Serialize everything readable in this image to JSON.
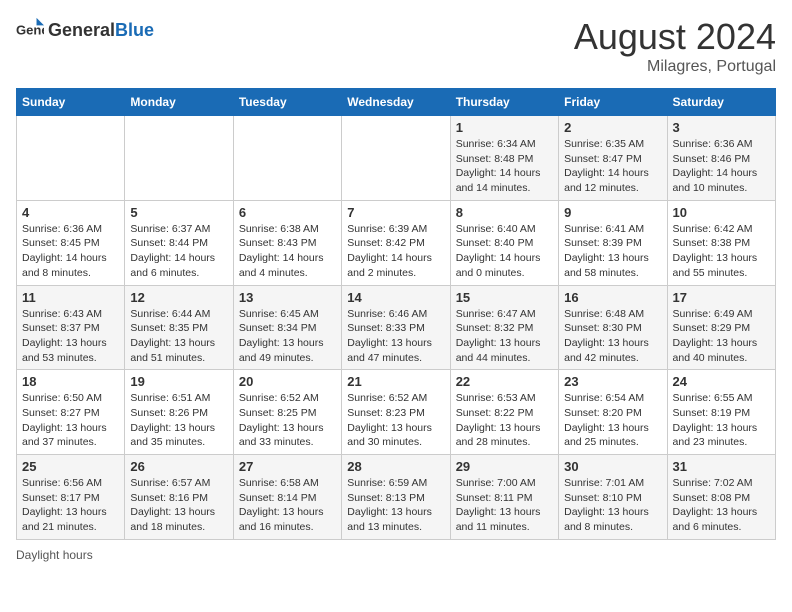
{
  "header": {
    "logo_general": "General",
    "logo_blue": "Blue",
    "month_year": "August 2024",
    "location": "Milagres, Portugal"
  },
  "days_of_week": [
    "Sunday",
    "Monday",
    "Tuesday",
    "Wednesday",
    "Thursday",
    "Friday",
    "Saturday"
  ],
  "footer": {
    "note": "Daylight hours"
  },
  "weeks": [
    [
      {
        "day": "",
        "info": ""
      },
      {
        "day": "",
        "info": ""
      },
      {
        "day": "",
        "info": ""
      },
      {
        "day": "",
        "info": ""
      },
      {
        "day": "1",
        "info": "Sunrise: 6:34 AM\nSunset: 8:48 PM\nDaylight: 14 hours and 14 minutes."
      },
      {
        "day": "2",
        "info": "Sunrise: 6:35 AM\nSunset: 8:47 PM\nDaylight: 14 hours and 12 minutes."
      },
      {
        "day": "3",
        "info": "Sunrise: 6:36 AM\nSunset: 8:46 PM\nDaylight: 14 hours and 10 minutes."
      }
    ],
    [
      {
        "day": "4",
        "info": "Sunrise: 6:36 AM\nSunset: 8:45 PM\nDaylight: 14 hours and 8 minutes."
      },
      {
        "day": "5",
        "info": "Sunrise: 6:37 AM\nSunset: 8:44 PM\nDaylight: 14 hours and 6 minutes."
      },
      {
        "day": "6",
        "info": "Sunrise: 6:38 AM\nSunset: 8:43 PM\nDaylight: 14 hours and 4 minutes."
      },
      {
        "day": "7",
        "info": "Sunrise: 6:39 AM\nSunset: 8:42 PM\nDaylight: 14 hours and 2 minutes."
      },
      {
        "day": "8",
        "info": "Sunrise: 6:40 AM\nSunset: 8:40 PM\nDaylight: 14 hours and 0 minutes."
      },
      {
        "day": "9",
        "info": "Sunrise: 6:41 AM\nSunset: 8:39 PM\nDaylight: 13 hours and 58 minutes."
      },
      {
        "day": "10",
        "info": "Sunrise: 6:42 AM\nSunset: 8:38 PM\nDaylight: 13 hours and 55 minutes."
      }
    ],
    [
      {
        "day": "11",
        "info": "Sunrise: 6:43 AM\nSunset: 8:37 PM\nDaylight: 13 hours and 53 minutes."
      },
      {
        "day": "12",
        "info": "Sunrise: 6:44 AM\nSunset: 8:35 PM\nDaylight: 13 hours and 51 minutes."
      },
      {
        "day": "13",
        "info": "Sunrise: 6:45 AM\nSunset: 8:34 PM\nDaylight: 13 hours and 49 minutes."
      },
      {
        "day": "14",
        "info": "Sunrise: 6:46 AM\nSunset: 8:33 PM\nDaylight: 13 hours and 47 minutes."
      },
      {
        "day": "15",
        "info": "Sunrise: 6:47 AM\nSunset: 8:32 PM\nDaylight: 13 hours and 44 minutes."
      },
      {
        "day": "16",
        "info": "Sunrise: 6:48 AM\nSunset: 8:30 PM\nDaylight: 13 hours and 42 minutes."
      },
      {
        "day": "17",
        "info": "Sunrise: 6:49 AM\nSunset: 8:29 PM\nDaylight: 13 hours and 40 minutes."
      }
    ],
    [
      {
        "day": "18",
        "info": "Sunrise: 6:50 AM\nSunset: 8:27 PM\nDaylight: 13 hours and 37 minutes."
      },
      {
        "day": "19",
        "info": "Sunrise: 6:51 AM\nSunset: 8:26 PM\nDaylight: 13 hours and 35 minutes."
      },
      {
        "day": "20",
        "info": "Sunrise: 6:52 AM\nSunset: 8:25 PM\nDaylight: 13 hours and 33 minutes."
      },
      {
        "day": "21",
        "info": "Sunrise: 6:52 AM\nSunset: 8:23 PM\nDaylight: 13 hours and 30 minutes."
      },
      {
        "day": "22",
        "info": "Sunrise: 6:53 AM\nSunset: 8:22 PM\nDaylight: 13 hours and 28 minutes."
      },
      {
        "day": "23",
        "info": "Sunrise: 6:54 AM\nSunset: 8:20 PM\nDaylight: 13 hours and 25 minutes."
      },
      {
        "day": "24",
        "info": "Sunrise: 6:55 AM\nSunset: 8:19 PM\nDaylight: 13 hours and 23 minutes."
      }
    ],
    [
      {
        "day": "25",
        "info": "Sunrise: 6:56 AM\nSunset: 8:17 PM\nDaylight: 13 hours and 21 minutes."
      },
      {
        "day": "26",
        "info": "Sunrise: 6:57 AM\nSunset: 8:16 PM\nDaylight: 13 hours and 18 minutes."
      },
      {
        "day": "27",
        "info": "Sunrise: 6:58 AM\nSunset: 8:14 PM\nDaylight: 13 hours and 16 minutes."
      },
      {
        "day": "28",
        "info": "Sunrise: 6:59 AM\nSunset: 8:13 PM\nDaylight: 13 hours and 13 minutes."
      },
      {
        "day": "29",
        "info": "Sunrise: 7:00 AM\nSunset: 8:11 PM\nDaylight: 13 hours and 11 minutes."
      },
      {
        "day": "30",
        "info": "Sunrise: 7:01 AM\nSunset: 8:10 PM\nDaylight: 13 hours and 8 minutes."
      },
      {
        "day": "31",
        "info": "Sunrise: 7:02 AM\nSunset: 8:08 PM\nDaylight: 13 hours and 6 minutes."
      }
    ]
  ]
}
